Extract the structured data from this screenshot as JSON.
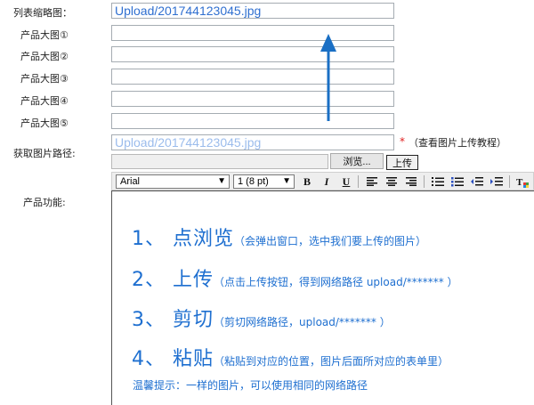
{
  "form": {
    "list_thumb_label": "列表缩略图：",
    "list_thumb_value": "Upload/201744123045.jpg",
    "large_images": [
      {
        "label": "产品大图①",
        "value": ""
      },
      {
        "label": "产品大图②",
        "value": ""
      },
      {
        "label": "产品大图③",
        "value": ""
      },
      {
        "label": "产品大图④",
        "value": ""
      },
      {
        "label": "产品大图⑤",
        "value": ""
      }
    ],
    "path_label": "获取图片路径:",
    "path_value": "Upload/201744123045.jpg",
    "required_mark": "*",
    "path_hint": "（查看图片上传教程）",
    "browse_label": "浏览...",
    "upload_label": "上传",
    "function_label": "产品功能:"
  },
  "toolbar": {
    "font_family": "Arial",
    "font_size": "1 (8 pt)",
    "bold": "B",
    "italic": "I",
    "underline": "U"
  },
  "editor": {
    "steps": [
      {
        "num": "1、",
        "title": "点浏览",
        "note": "（会弹出窗口，选中我们要上传的图片）"
      },
      {
        "num": "2、",
        "title": "上传",
        "note": "（点击上传按钮，得到网络路径 upload/******* ）"
      },
      {
        "num": "3、",
        "title": "剪切",
        "note": "（剪切网络路径，upload/******* ）"
      },
      {
        "num": "4、",
        "title": "粘贴",
        "note": "（粘贴到对应的位置，图片后面所对应的表单里）"
      }
    ],
    "tip": "温馨提示：一样的图片，可以使用相同的网络路径"
  },
  "colors": {
    "accent": "#1e6fd0",
    "arrow": "#1a6fc4",
    "required": "#e02020"
  }
}
